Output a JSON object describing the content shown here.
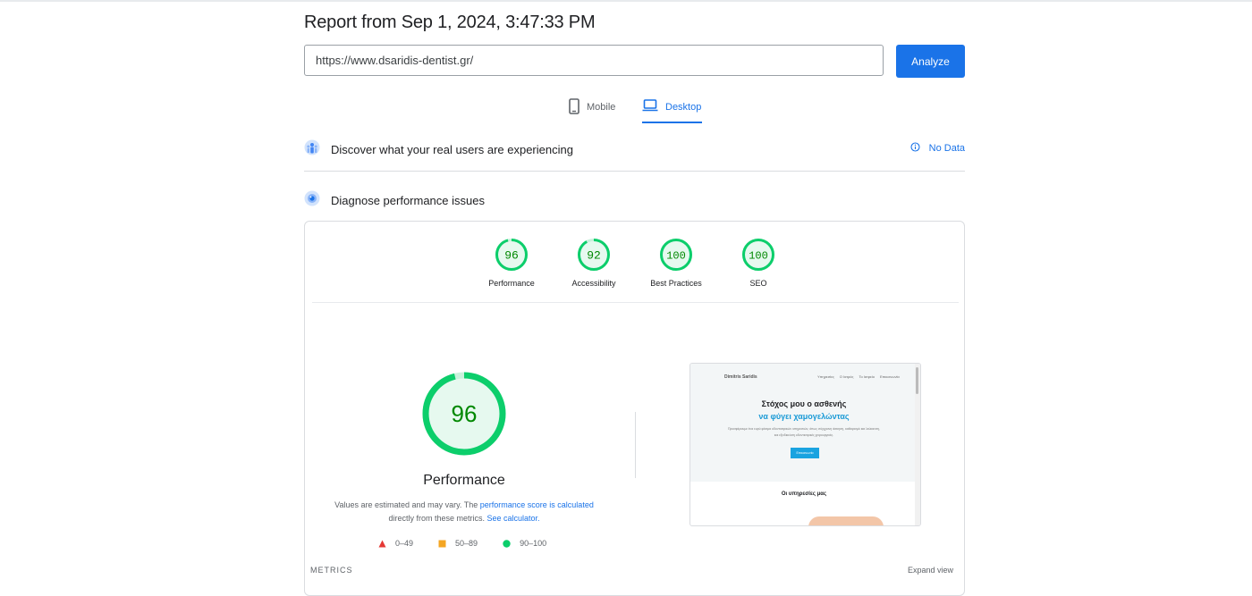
{
  "report": {
    "title": "Report from Sep 1, 2024, 3:47:33 PM"
  },
  "search": {
    "url_value": "https://www.dsaridis-dentist.gr/",
    "analyze_label": "Analyze"
  },
  "tabs": [
    {
      "label": "Mobile",
      "icon": "phone-icon",
      "active": false
    },
    {
      "label": "Desktop",
      "icon": "laptop-icon",
      "active": true
    }
  ],
  "crux": {
    "title": "Discover what your real users are experiencing",
    "status": "No Data",
    "icon": "people-icon"
  },
  "diagnose": {
    "title": "Diagnose performance issues",
    "icon": "lighthouse-icon"
  },
  "scores": [
    {
      "value": 96,
      "display": "96",
      "label": "Performance"
    },
    {
      "value": 92,
      "display": "92",
      "label": "Accessibility"
    },
    {
      "value": 100,
      "display": "100",
      "label": "Best Practices"
    },
    {
      "value": 100,
      "display": "100",
      "label": "SEO"
    }
  ],
  "performance": {
    "score": 96,
    "score_display": "96",
    "label": "Performance",
    "desc_prefix": "Values are estimated and may vary. The ",
    "desc_link1": "performance score is calculated",
    "desc_middle": "directly from these metrics. ",
    "desc_link2": "See calculator."
  },
  "legend": [
    {
      "range": "0–49",
      "shape": "triangle",
      "color": "#e53935"
    },
    {
      "range": "50–89",
      "shape": "square",
      "color": "#f4a623"
    },
    {
      "range": "90–100",
      "shape": "circle",
      "color": "#0cce6b"
    }
  ],
  "screenshot": {
    "logo": "Dimitris Saridis",
    "nav": [
      "Υπηρεσίες",
      "Ο Ιατρός",
      "Το Ιατρείο",
      "Επικοινωνία"
    ],
    "headline1": "Στόχος μου ο ασθενής",
    "headline2": "να φύγει χαμογελώντας",
    "paragraph": "Προσφέρουμε ένα ευρύ φάσμα οδοντιατρικών υπηρεσιών, όπως σύγχρονη άσκηση, καθαρισμό και λεύκανση, και εξειδικεύση οδοντιατρικές χειρουργικές.",
    "button": "Επικοινωνία",
    "services": "Οι υπηρεσίες μας"
  },
  "metrics": {
    "label": "METRICS",
    "expand_label": "Expand view"
  },
  "colors": {
    "good": "#0cce6b",
    "good_text": "#008800",
    "accent": "#1a73e8"
  }
}
